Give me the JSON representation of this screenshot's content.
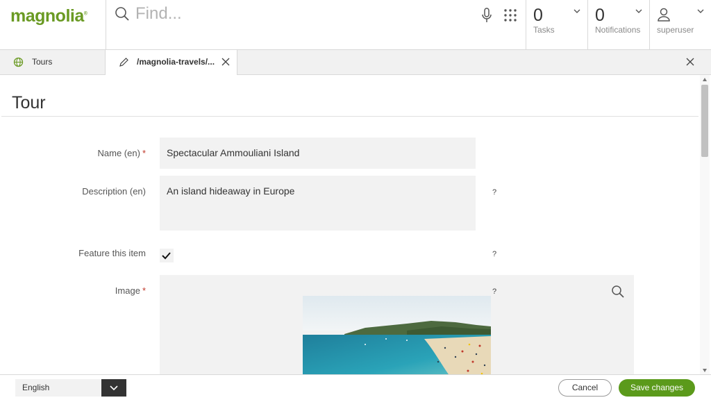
{
  "header": {
    "logo": "magnolia",
    "search_placeholder": "Find...",
    "tasks": {
      "count": "0",
      "label": "Tasks"
    },
    "notifications": {
      "count": "0",
      "label": "Notifications"
    },
    "user": {
      "name": "superuser"
    }
  },
  "tabs": [
    {
      "label": "Tours",
      "icon": "globe-icon"
    },
    {
      "label": "/magnolia-travels/...",
      "icon": "pencil-icon"
    }
  ],
  "form": {
    "title": "Tour",
    "fields": {
      "name": {
        "label": "Name (en)",
        "required": "*",
        "value": "Spectacular Ammouliani Island"
      },
      "description": {
        "label": "Description (en)",
        "value": "An island hideaway in Europe",
        "help": "?"
      },
      "feature": {
        "label": "Feature this item",
        "checked": true,
        "help": "?"
      },
      "image": {
        "label": "Image",
        "required": "*",
        "help": "?"
      }
    }
  },
  "footer": {
    "language": "English",
    "cancel_label": "Cancel",
    "save_label": "Save changes"
  },
  "colors": {
    "brand": "#6a9a23",
    "save_button": "#5b9a1b",
    "field_bg": "#f2f2f2"
  }
}
